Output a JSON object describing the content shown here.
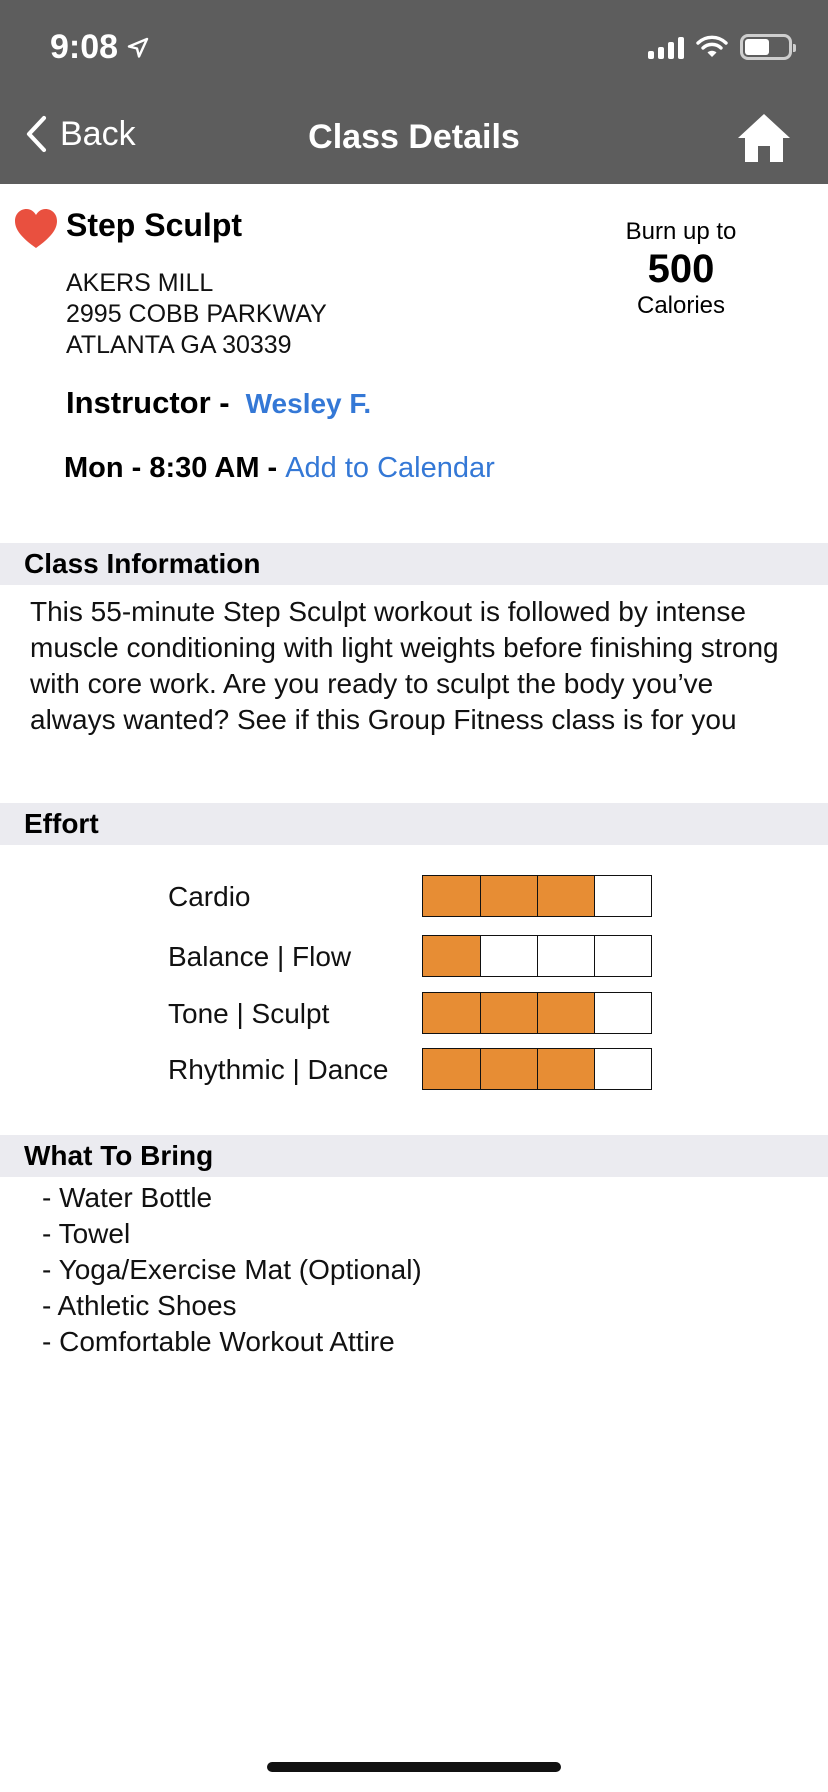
{
  "status_bar": {
    "time": "9:08"
  },
  "nav": {
    "back_label": "Back",
    "title": "Class Details"
  },
  "class": {
    "name": "Step Sculpt",
    "favorite": true,
    "address": [
      "AKERS MILL",
      "2995 COBB PARKWAY",
      "ATLANTA GA 30339"
    ],
    "instructor_label": "Instructor -",
    "instructor_name": "Wesley F.",
    "schedule": "Mon - 8:30 AM -",
    "add_to_calendar": "Add to Calendar"
  },
  "calories": {
    "pre": "Burn up to",
    "value": "500",
    "post": "Calories"
  },
  "class_information": {
    "heading": "Class Information",
    "description": "This 55-minute Step Sculpt workout is followed by intense muscle conditioning with light weights before finishing strong with core work. Are you ready to sculpt the body you’ve always wanted? See if this Group Fitness class is for you"
  },
  "effort": {
    "heading": "Effort",
    "max_level": 4,
    "accent_color": "#e78d34",
    "rows": [
      {
        "label": "Cardio",
        "level": 3
      },
      {
        "label": "Balance | Flow",
        "level": 1
      },
      {
        "label": "Tone | Sculpt",
        "level": 3
      },
      {
        "label": "Rhythmic | Dance",
        "level": 3
      }
    ]
  },
  "what_to_bring": {
    "heading": "What To Bring",
    "items": [
      "- Water Bottle",
      "- Towel",
      "- Yoga/Exercise Mat (Optional)",
      "- Athletic Shoes",
      "- Comfortable Workout Attire"
    ]
  },
  "icons": {
    "location": "location-arrow-icon",
    "signal": "cellular-signal-icon",
    "wifi": "wifi-icon",
    "battery": "battery-icon",
    "back": "chevron-left-icon",
    "home": "home-icon",
    "favorite": "heart-icon"
  }
}
